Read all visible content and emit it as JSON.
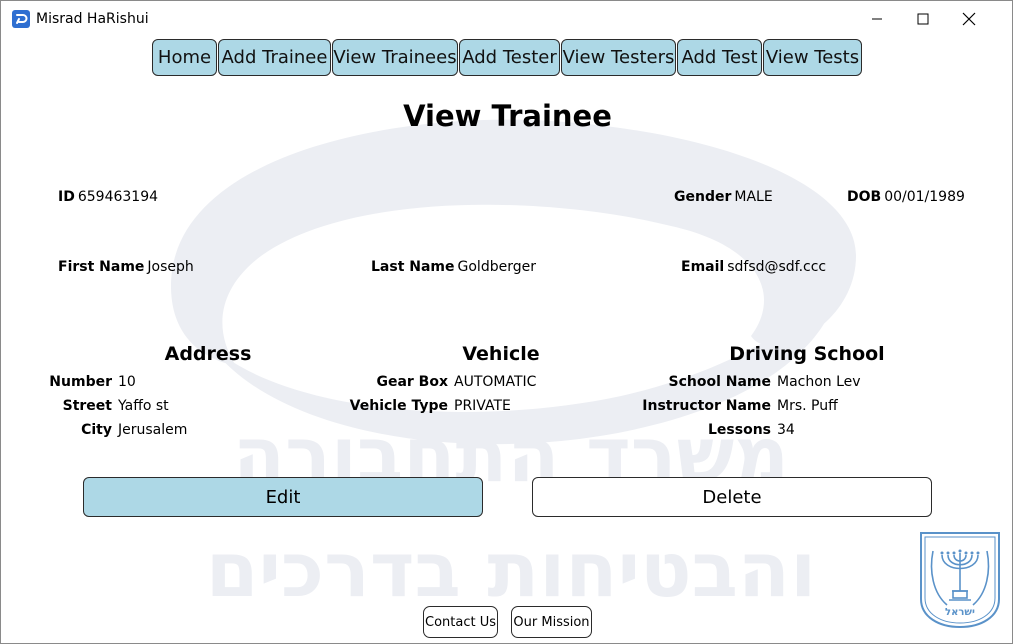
{
  "window": {
    "title": "Misrad HaRishui"
  },
  "nav": [
    "Home",
    "Add Trainee",
    "View Trainees",
    "Add Tester",
    "View Testers",
    "Add Test",
    "View Tests"
  ],
  "page_title": "View Trainee",
  "top_fields": {
    "id": {
      "label": "ID",
      "value": "659463194"
    },
    "gender": {
      "label": "Gender",
      "value": "MALE"
    },
    "dob": {
      "label": "DOB",
      "value": "00/01/1989"
    },
    "first_name": {
      "label": "First Name",
      "value": "Joseph"
    },
    "last_name": {
      "label": "Last Name",
      "value": "Goldberger"
    },
    "email": {
      "label": "Email",
      "value": "sdfsd@sdf.ccc"
    }
  },
  "address": {
    "title": "Address",
    "rows": [
      {
        "label": "Number",
        "value": "10"
      },
      {
        "label": "Street",
        "value": "Yaffo st"
      },
      {
        "label": "City",
        "value": "Jerusalem"
      }
    ]
  },
  "vehicle": {
    "title": "Vehicle",
    "rows": [
      {
        "label": "Gear Box",
        "value": "AUTOMATIC"
      },
      {
        "label": "Vehicle Type",
        "value": "PRIVATE"
      }
    ]
  },
  "driving_school": {
    "title": "Driving School",
    "rows": [
      {
        "label": "School Name",
        "value": "Machon Lev"
      },
      {
        "label": "Instructor Name",
        "value": "Mrs. Puff"
      },
      {
        "label": "Lessons",
        "value": "34"
      }
    ]
  },
  "actions": {
    "edit": "Edit",
    "delete": "Delete"
  },
  "footer": {
    "contact": "Contact Us",
    "mission": "Our Mission"
  },
  "watermark_text": {
    "line1": "משרד התחבורה",
    "line2": "והבטיחות בדרכים"
  },
  "emblem_text": "ישראל",
  "colors": {
    "button_blue": "#add8e6",
    "watermark": "#eceef3"
  }
}
